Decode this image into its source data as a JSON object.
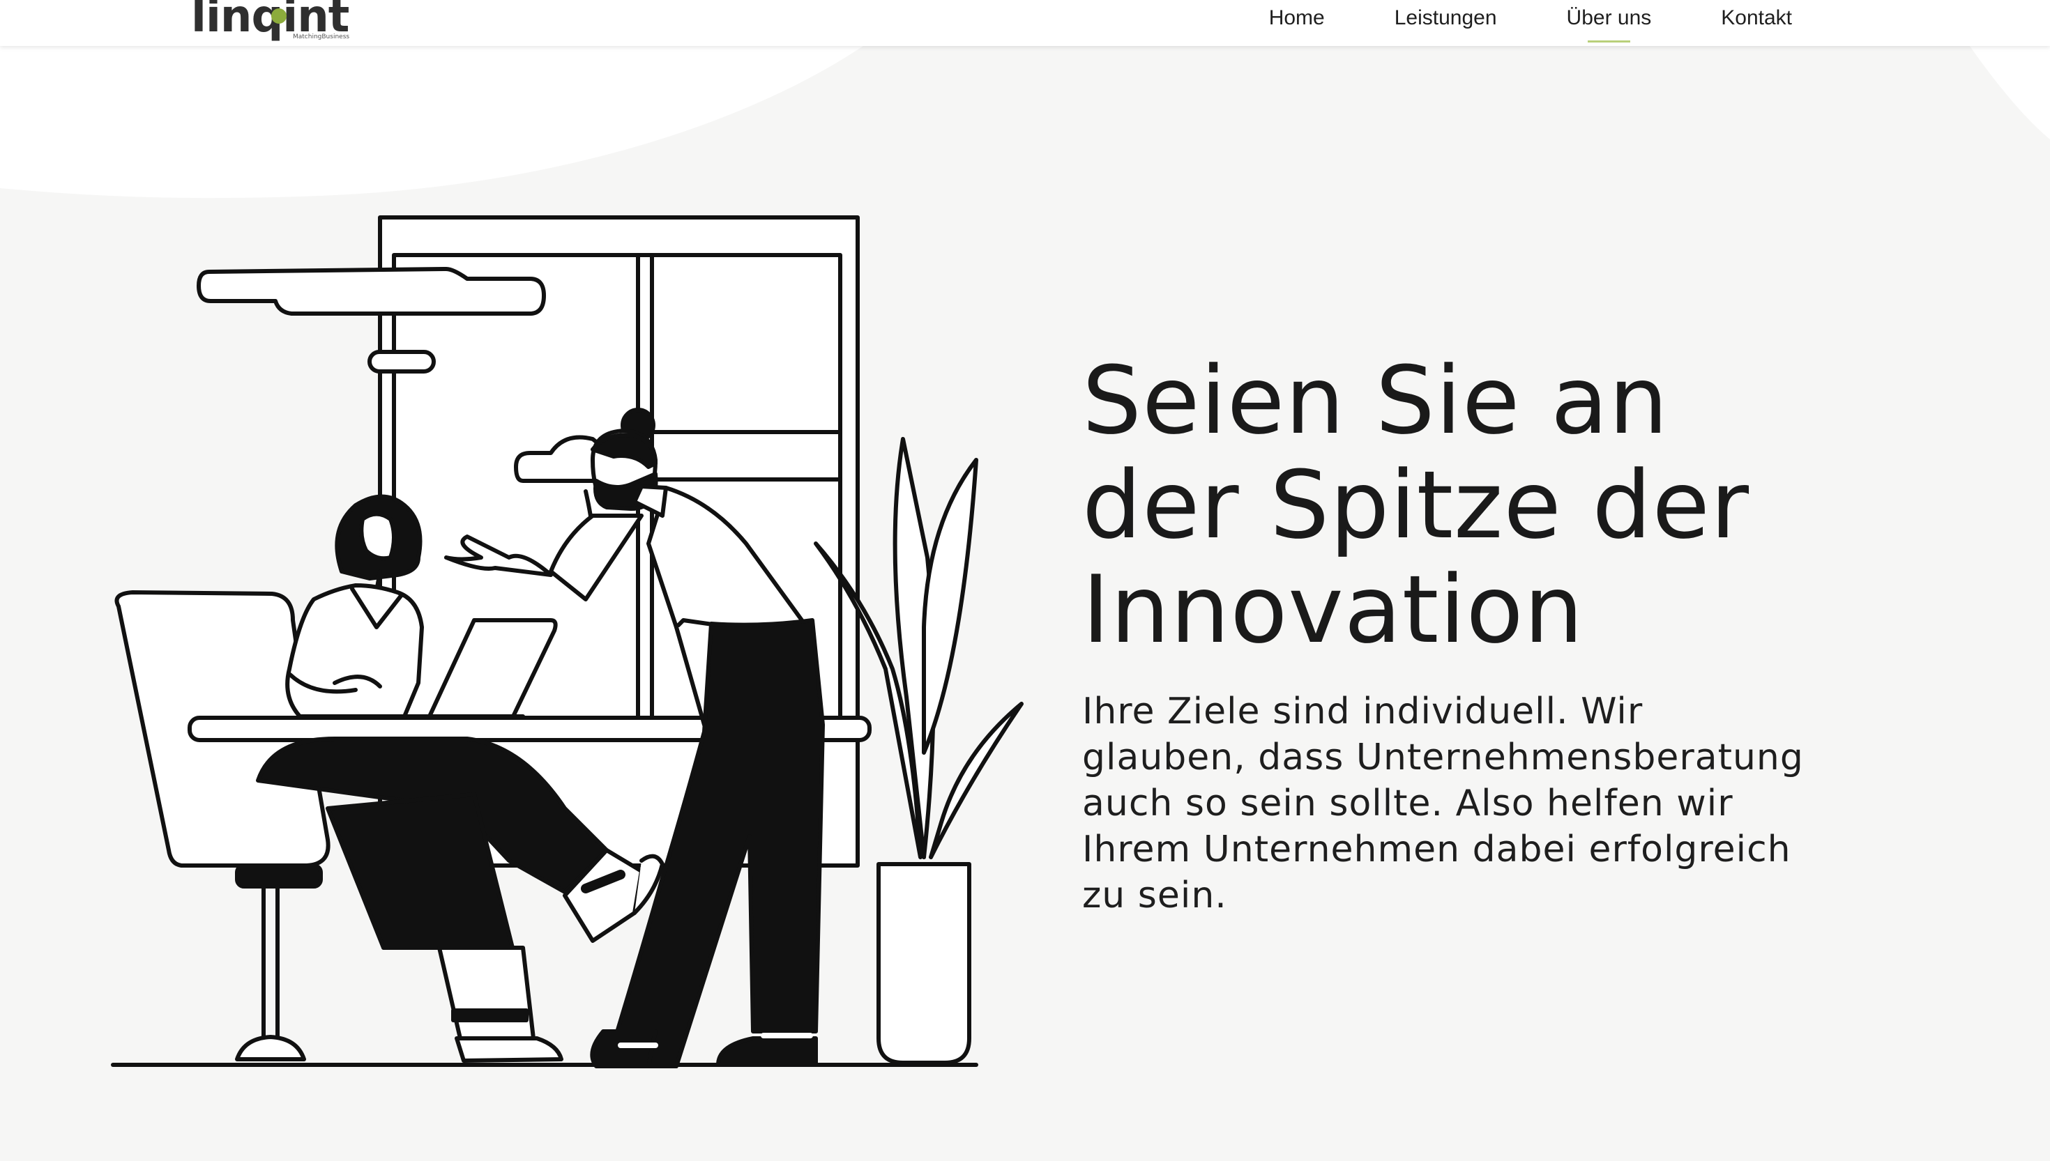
{
  "brand": {
    "logo_text": "linqint",
    "logo_tagline": "MatchingBusiness"
  },
  "nav": {
    "items": [
      {
        "label": "Home",
        "active": false
      },
      {
        "label": "Leistungen",
        "active": false
      },
      {
        "label": "Über uns",
        "active": true
      },
      {
        "label": "Kontakt",
        "active": false
      }
    ]
  },
  "hero": {
    "title": "Seien Sie an der Spitze der Innovation",
    "subtitle": "Ihre Ziele sind individuell. Wir glauben, dass Unternehmensberatung auch so sein sollte. Also helfen wir Ihrem Unternehmen dabei erfolgreich zu sein."
  },
  "colors": {
    "accent": "#8cab3c",
    "background": "#f6f6f5",
    "text": "#1a1a1a"
  }
}
